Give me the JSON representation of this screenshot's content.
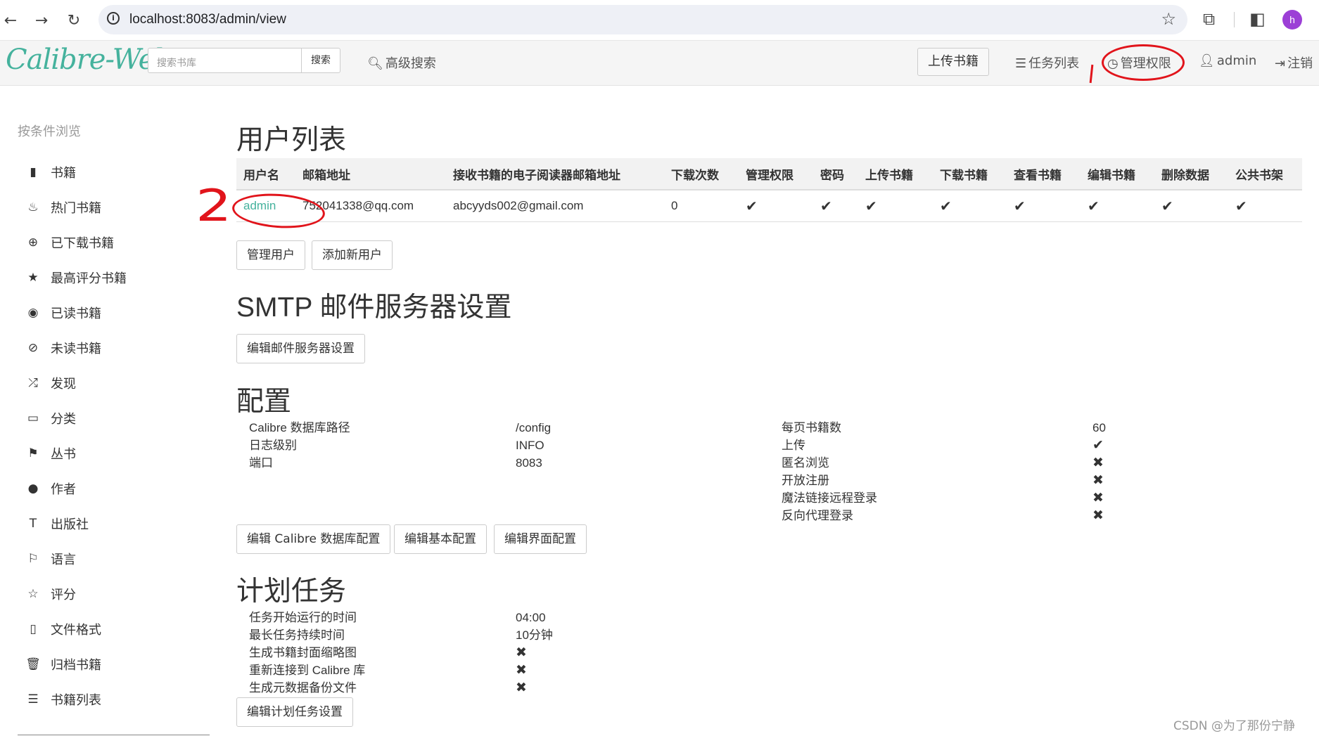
{
  "browser": {
    "url": "localhost:8083/admin/view",
    "profile_initial": "h"
  },
  "navbar": {
    "logo": "Calibre-Web",
    "search_placeholder": "搜索书库",
    "search_button": "搜索",
    "advanced_search": "高级搜索",
    "upload": "上传书籍",
    "tasks": "任务列表",
    "admin_panel": "管理权限",
    "user": "admin",
    "logout": "注销"
  },
  "sidebar": {
    "heading": "按条件浏览",
    "items": [
      {
        "label": "书籍",
        "icon": "book-icon"
      },
      {
        "label": "热门书籍",
        "icon": "fire-icon"
      },
      {
        "label": "已下载书籍",
        "icon": "download-icon"
      },
      {
        "label": "最高评分书籍",
        "icon": "star-icon"
      },
      {
        "label": "已读书籍",
        "icon": "eye-icon"
      },
      {
        "label": "未读书籍",
        "icon": "eye-slash-icon"
      },
      {
        "label": "发现",
        "icon": "random-icon"
      },
      {
        "label": "分类",
        "icon": "inbox-icon"
      },
      {
        "label": "丛书",
        "icon": "bookmark-icon"
      },
      {
        "label": "作者",
        "icon": "user-icon"
      },
      {
        "label": "出版社",
        "icon": "text-size-icon"
      },
      {
        "label": "语言",
        "icon": "flag-icon"
      },
      {
        "label": "评分",
        "icon": "star-empty-icon"
      },
      {
        "label": "文件格式",
        "icon": "file-icon"
      },
      {
        "label": "归档书籍",
        "icon": "trash-icon"
      },
      {
        "label": "书籍列表",
        "icon": "list-icon"
      }
    ]
  },
  "users": {
    "title": "用户列表",
    "columns": [
      "用户名",
      "邮箱地址",
      "接收书籍的电子阅读器邮箱地址",
      "下载次数",
      "管理权限",
      "密码",
      "上传书籍",
      "下载书籍",
      "查看书籍",
      "编辑书籍",
      "删除数据",
      "公共书架"
    ],
    "rows": [
      {
        "username": "admin",
        "email": "752041338@qq.com",
        "kindle_email": "abcyyds002@gmail.com",
        "downloads": "0",
        "marks": [
          "✔",
          "✔",
          "✔",
          "✔",
          "✔",
          "✔",
          "✔",
          "✔"
        ]
      }
    ],
    "manage_button": "管理用户",
    "add_button": "添加新用户"
  },
  "smtp": {
    "title": "SMTP 邮件服务器设置",
    "edit_button": "编辑邮件服务器设置"
  },
  "config": {
    "title": "配置",
    "left": [
      {
        "label": "Calibre 数据库路径",
        "value": "/config"
      },
      {
        "label": "日志级别",
        "value": "INFO"
      },
      {
        "label": "端口",
        "value": "8083"
      }
    ],
    "right": [
      {
        "label": "每页书籍数",
        "value": "60"
      },
      {
        "label": "上传",
        "value": "✔"
      },
      {
        "label": "匿名浏览",
        "value": "✖"
      },
      {
        "label": "开放注册",
        "value": "✖"
      },
      {
        "label": "魔法链接远程登录",
        "value": "✖"
      },
      {
        "label": "反向代理登录",
        "value": "✖"
      }
    ],
    "buttons": [
      "编辑 Calibre 数据库配置",
      "编辑基本配置",
      "编辑界面配置"
    ]
  },
  "schedule": {
    "title": "计划任务",
    "items": [
      {
        "label": "任务开始运行的时间",
        "value": "04:00"
      },
      {
        "label": "最长任务持续时间",
        "value": "10分钟"
      },
      {
        "label": "生成书籍封面缩略图",
        "value": "✖"
      },
      {
        "label": "重新连接到 Calibre 库",
        "value": "✖"
      },
      {
        "label": "生成元数据备份文件",
        "value": "✖"
      }
    ],
    "edit_button": "编辑计划任务设置"
  },
  "watermark": "CSDN @为了那份宁静",
  "colors": {
    "brand": "#45b29d",
    "annotation": "#e1141b"
  }
}
